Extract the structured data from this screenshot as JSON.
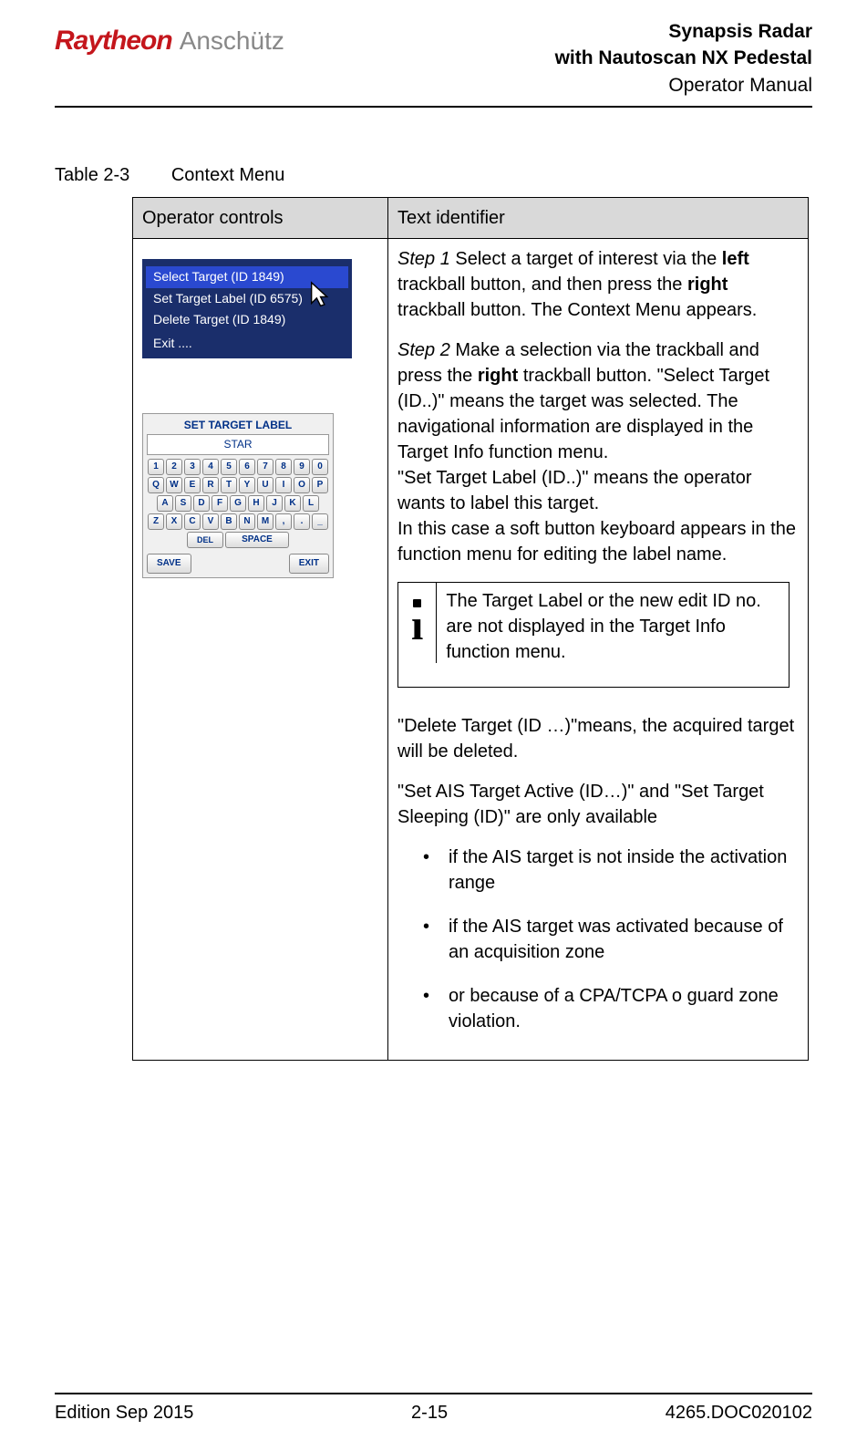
{
  "header": {
    "logo": {
      "raytheon": "Raytheon",
      "anschutz": "Anschütz"
    },
    "title_line1": "Synapsis Radar",
    "title_line2": "with Nautoscan NX Pedestal",
    "title_line3": "Operator Manual"
  },
  "table_caption": {
    "num": "Table 2-3",
    "title": "Context Menu"
  },
  "table": {
    "h1": "Operator controls",
    "h2": "Text identifier"
  },
  "ctx": {
    "i1": "Select Target (ID 1849)",
    "i2": "Set Target Label (ID 6575)",
    "i3": "Delete Target (ID 1849)",
    "i4": "Exit ...."
  },
  "kb": {
    "title": "SET TARGET LABEL",
    "value": "STAR",
    "r1": [
      "1",
      "2",
      "3",
      "4",
      "5",
      "6",
      "7",
      "8",
      "9",
      "0"
    ],
    "r2": [
      "Q",
      "W",
      "E",
      "R",
      "T",
      "Y",
      "U",
      "I",
      "O",
      "P"
    ],
    "r3": [
      "A",
      "S",
      "D",
      "F",
      "G",
      "H",
      "J",
      "K",
      "L"
    ],
    "r4": [
      "Z",
      "X",
      "C",
      "V",
      "B",
      "N",
      "M",
      ",",
      ".",
      "_"
    ],
    "del": "DEL",
    "space": "SPACE",
    "save": "SAVE",
    "exit": "EXIT"
  },
  "desc": {
    "step1_lbl": "Step 1",
    "step1_a": " Select a target of interest via the ",
    "step1_b1": "left",
    "step1_c": " trackball button, and then press the ",
    "step1_b2": "right",
    "step1_d": " trackball button. The Context Menu appears.",
    "step2_lbl": "Step 2",
    "step2_a": " Make a selection via the trackball and press the ",
    "step2_b1": "right",
    "step2_c": " trackball button. \"Select Target (ID..)\" means the target was selected. The navigational information are displayed in the Target Info function menu.",
    "step2_d": "\"Set Target Label (ID..)\" means the operator wants to label this target.",
    "step2_e": "In this case a soft button keyboard appears in the function menu for editing the label name.",
    "info": "The Target Label or the new edit ID no. are not displayed in the Target Info function menu.",
    "p3": "\"Delete Target (ID …)\"means, the acquired target will be deleted.",
    "p4": "\"Set AIS Target Active (ID…)\" and \"Set Target Sleeping (ID)\" are only available",
    "b1": "if the AIS target is not inside the activation range",
    "b2": "if the AIS target was activated because of an acquisition zone",
    "b3": "or because of a CPA/TCPA o guard zone violation."
  },
  "footer": {
    "left": "Edition Sep 2015",
    "center": "2-15",
    "right": "4265.DOC020102"
  }
}
